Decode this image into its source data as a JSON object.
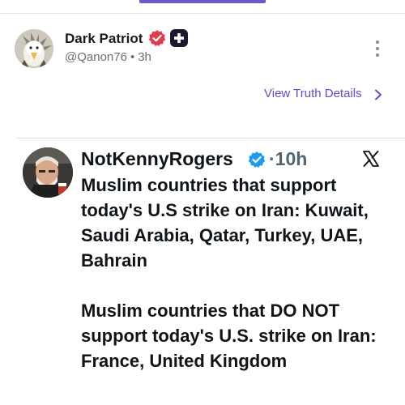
{
  "post": {
    "author_name": "Dark Patriot",
    "handle": "@Qanon76",
    "separator": "•",
    "time": "3h",
    "view_details_label": "View Truth Details",
    "avatar_icon": "eagle-avatar",
    "verified_badge_icon": "verified-badge-icon",
    "plus_badge_icon": "plus-badge-icon",
    "menu_icon": "more-vertical-icon"
  },
  "embed": {
    "author_name": "NotKennyRogers",
    "separator": "·",
    "time": "10h",
    "platform_icon": "x-logo-icon",
    "paragraphs": [
      "Muslim countries that support today's U.S strike on Iran: Kuwait, Saudi Arabia, Qatar, Turkey, UAE, Bahrain",
      "Muslim countries that DO NOT support today's U.S. strike on Iran: France, United Kingdom"
    ]
  },
  "colors": {
    "accent": "#5b4fd6",
    "verified_red": "#e23b4e",
    "x_verified_blue": "#1d9bf0"
  }
}
